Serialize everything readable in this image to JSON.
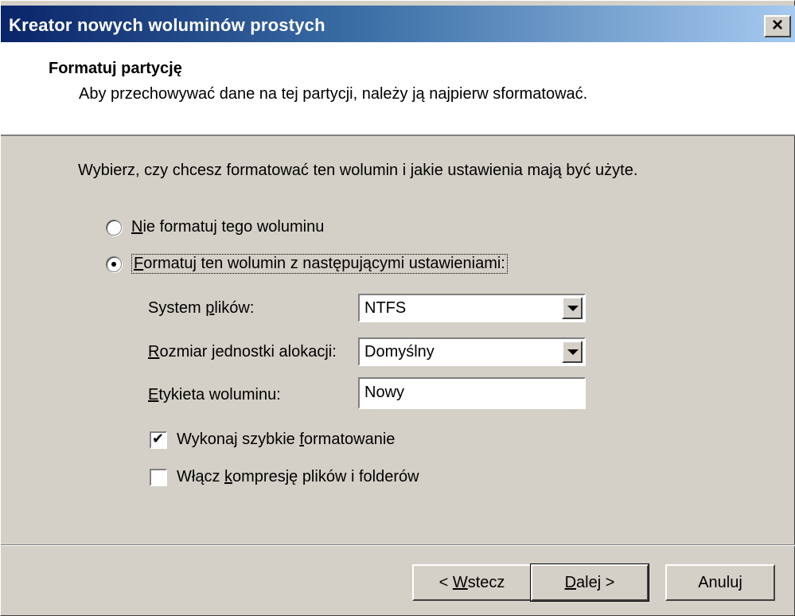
{
  "window": {
    "title": "Kreator nowych woluminów prostych",
    "close_glyph": "×"
  },
  "header": {
    "title": "Formatuj partycję",
    "subtitle": "Aby przechowywać dane na tej partycji, należy ją najpierw sformatować."
  },
  "instruction": "Wybierz, czy chcesz formatować ten wolumin i jakie ustawienia mają być użyte.",
  "options": {
    "no_format": {
      "mnemonic": "N",
      "rest": "ie formatuj tego woluminu",
      "selected": false
    },
    "format": {
      "mnemonic": "F",
      "rest": "ormatuj ten wolumin z następującymi ustawieniami:",
      "selected": true
    }
  },
  "fields": {
    "filesystem": {
      "pre": "System ",
      "mnemonic": "p",
      "post": "lików:",
      "value": "NTFS"
    },
    "allocation": {
      "pre": "",
      "mnemonic": "R",
      "post": "ozmiar jednostki alokacji:",
      "value": "Domyślny"
    },
    "label": {
      "pre": "",
      "mnemonic": "E",
      "post": "tykieta woluminu:",
      "value": "Nowy"
    }
  },
  "checks": {
    "quick_format": {
      "pre": "Wykonaj szybkie ",
      "mnemonic": "f",
      "post": "ormatowanie",
      "checked": true
    },
    "compression": {
      "pre": "Włącz ",
      "mnemonic": "k",
      "post": "ompresję plików i folderów",
      "checked": false
    }
  },
  "buttons": {
    "back": {
      "pre": "< ",
      "mnemonic": "W",
      "post": "stecz"
    },
    "next": {
      "pre": "",
      "mnemonic": "D",
      "post": "alej >"
    },
    "cancel": {
      "label": "Anuluj"
    }
  },
  "colors": {
    "title_gradient_start": "#0a246a",
    "title_gradient_end": "#a6caf0",
    "dialog_face": "#d4d0c8"
  }
}
